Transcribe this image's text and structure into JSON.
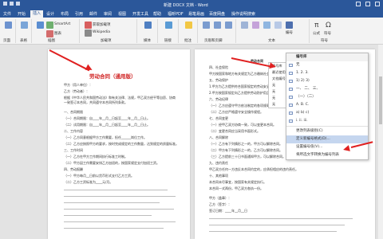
{
  "window": {
    "title": "新建 DOCX 文档 - Word"
  },
  "menu": {
    "tabs": [
      "文件",
      "开始",
      "插入",
      "设计",
      "布局",
      "引用",
      "邮件",
      "审阅",
      "视图",
      "开发工具",
      "帮助",
      "福昕PDF",
      "易笔易画",
      "百度网盘",
      "操作说明搜索"
    ]
  },
  "ribbon": {
    "groups": [
      "页面",
      "表格",
      "插图",
      "加载项",
      "媒体",
      "链接",
      "批注",
      "页眉和页脚",
      "文本",
      "符号"
    ],
    "labels": {
      "smartart": "SmartArt",
      "chart": "图表",
      "screenshot": "屏幕截图",
      "wikipedia": "Wikipedia",
      "get_addins": "获取加载项",
      "my_addins": "我的加载项",
      "online_video": "联机视频",
      "links": "链接",
      "comment": "批注",
      "header": "页眉",
      "footer": "页脚",
      "page_number": "页码",
      "textbox": "文本框",
      "equation": "公式",
      "symbol": "符号",
      "number": "编号"
    }
  },
  "left_page": {
    "title": "劳动合同（通用版）",
    "lines": [
      "甲方（用人单位）：",
      "乙方（劳动者）：",
      "根据《中华人民共和国劳动法》和有关法律、法规，甲乙双方经平等自愿、协商一致签订本合同，共同遵守本合同所列条款。",
      "一、合同期限",
      "（一）合同期限：自____年__月__日起至____年__月__日止。",
      "（二）试用期限：自____年__月__日起至____年__月__日止。",
      "二、工作内容",
      "（一）乙方同意根据甲方工作需要，担任______岗位工作。",
      "（二）乙方应按照甲方的要求，按时完成规定的工作数量，达到规定的质量标准。",
      "三、工作时间",
      "（一）乙方在甲方工作期间执行标准工时制。",
      "（二）甲方因工作需要安排乙方加班的，按国家规定支付加班工资。",
      "四、劳动报酬",
      "（一）甲方每月__日前以货币形式支付乙方工资。",
      "（二）乙方工资标准为____元/月。"
    ]
  },
  "right_page": {
    "heading": "劳动合同",
    "lines": [
      "四、社会保险",
      "甲方按国家和地方有关规定为乙方缴纳社会保险费。",
      "五、劳动保护",
      "1.甲方为乙方提供符合国家规定的劳动安全卫生条件。",
      "2.甲方按国家规定向乙方提供劳动防护用品。",
      "六、劳动纪律",
      "（一）乙方应遵守甲方依法制定的各项规章制度。",
      "（二）乙方应严格遵守安全操作规程。",
      "七、合同变更",
      "（一）经甲乙双方协商一致，可以变更本合同。",
      "（二）变更合同应当采用书面形式。",
      "八、合同解除",
      "（一）乙方有下列情形之一的，甲方可以解除合同。",
      "（二）甲方有下列情形之一的，乙方可以解除合同。",
      "（三）乙方提前三十日书面通知甲方，可以解除合同。",
      "九、违约责任",
      "甲乙双方任何一方违反本合同约定的，应承担相应的违约责任。",
      "十、其他事项",
      "本合同未尽事宜，按国家有关规定执行。",
      "本合同一式两份，甲乙双方各执一份。",
      "甲方（盖章）：",
      "乙方（签字）：",
      "签订日期：____年__月__日"
    ]
  },
  "number_menu": {
    "header": "编号库",
    "items": [
      "无",
      "1.  2.  3.",
      "1)  2)  3)",
      "一、 二、 三、",
      "（一）（二）",
      "A.  B.  C.",
      "a)  b)  c)",
      "i.  ii.  iii.",
      "更改列表级别(C)",
      "定义新编号格式(D)...",
      "设置编号值(V)...",
      "将所选文字转换为编号列表"
    ],
    "highlighted_index": 9
  },
  "submenu": {
    "items": [
      "编号库",
      "最近使用",
      "文档编号",
      "无",
      "无",
      "无",
      "无"
    ]
  }
}
